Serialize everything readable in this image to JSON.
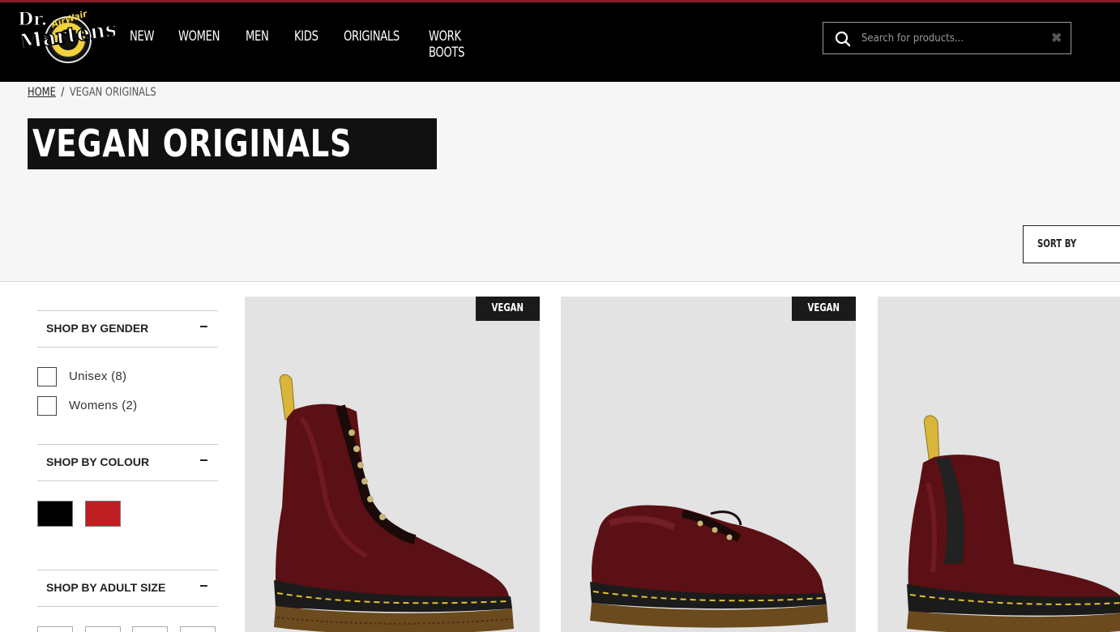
{
  "brand": {
    "logo_text": "Dr. Martens AirWair"
  },
  "nav": {
    "items": [
      "NEW",
      "WOMEN",
      "MEN",
      "KIDS",
      "ORIGINALS",
      "WORK BOOTS"
    ]
  },
  "search": {
    "placeholder": "Search for products...",
    "value": ""
  },
  "breadcrumb": {
    "home": "HOME",
    "separator": "/",
    "current": "VEGAN ORIGINALS"
  },
  "page": {
    "title": "VEGAN ORIGINALS",
    "sort_label": "SORT BY"
  },
  "filters": {
    "gender": {
      "title": "SHOP BY GENDER",
      "toggle": "−",
      "options": [
        {
          "label": "Unisex",
          "count": "(8)"
        },
        {
          "label": "Womens",
          "count": "(2)"
        }
      ]
    },
    "colour": {
      "title": "SHOP BY COLOUR",
      "toggle": "−",
      "swatches": [
        {
          "name": "Black",
          "color": "#000000"
        },
        {
          "name": "Red",
          "color": "#bf1e22"
        }
      ]
    },
    "size": {
      "title": "SHOP BY ADULT SIZE",
      "toggle": "−"
    }
  },
  "products": [
    {
      "badge": "VEGAN",
      "kind": "8-eye boot",
      "color": "cherry red"
    },
    {
      "badge": "VEGAN",
      "kind": "3-eye shoe",
      "color": "cherry red"
    },
    {
      "badge": "",
      "kind": "chelsea boot",
      "color": "cherry red"
    }
  ],
  "colors": {
    "header_bg": "#000000",
    "header_accent": "#8a1f2c",
    "page_bg": "#f6f6f6",
    "card_bg": "#e3e3e3",
    "leather": "#5a1014",
    "sole": "#6b4a1e",
    "stitch": "#e5c230",
    "pull_tab": "#d9b63a"
  }
}
